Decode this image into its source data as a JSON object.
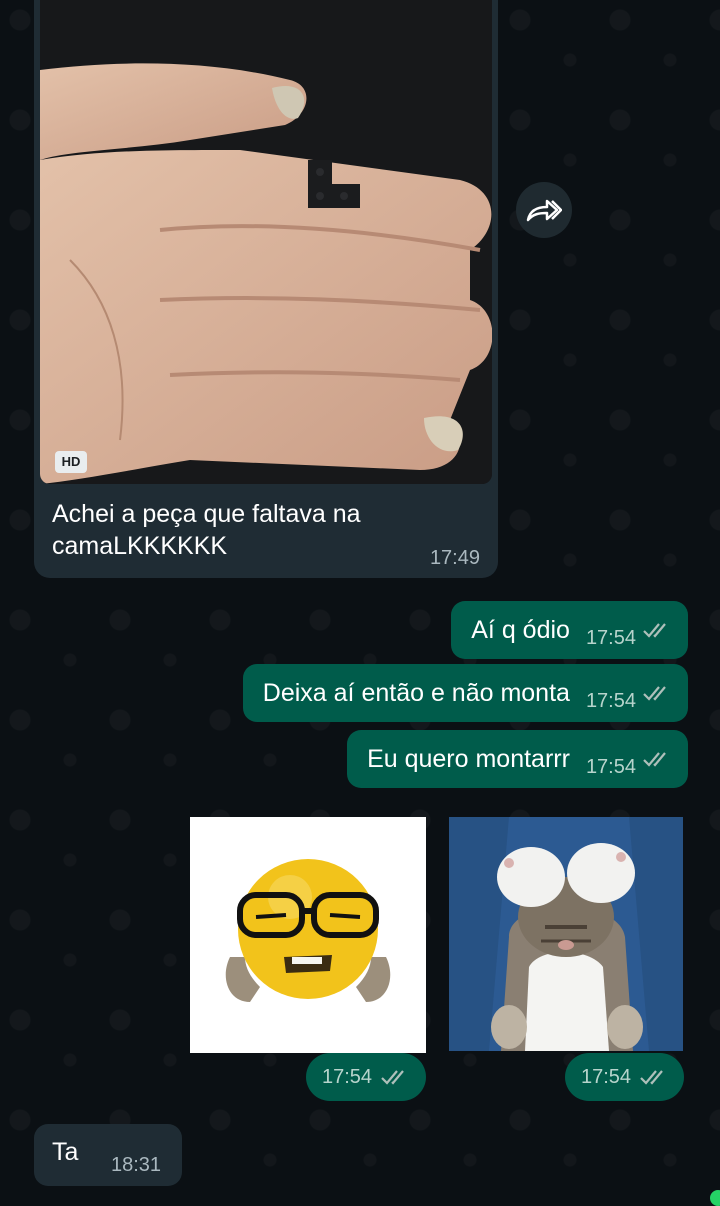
{
  "messages": {
    "photo": {
      "badge": "HD",
      "caption": "Achei a peça que faltava na camaLKKKKKK",
      "time": "17:49"
    },
    "out1": {
      "text": "Aí q ódio",
      "time": "17:54"
    },
    "out2": {
      "text": "Deixa aí então e não monta",
      "time": "17:54"
    },
    "out3": {
      "text": "Eu quero montarrr",
      "time": "17:54"
    },
    "sticker1": {
      "time": "17:54"
    },
    "sticker2": {
      "time": "17:54"
    },
    "in_ta": {
      "text": "Ta",
      "time": "18:31"
    }
  },
  "icons": {
    "forward": "forward-icon",
    "read_ticks": "double-check-icon"
  },
  "colors": {
    "background": "#0b1014",
    "incoming_bubble": "#1f2c34",
    "outgoing_bubble": "#005c4b",
    "online_dot": "#25d366"
  }
}
